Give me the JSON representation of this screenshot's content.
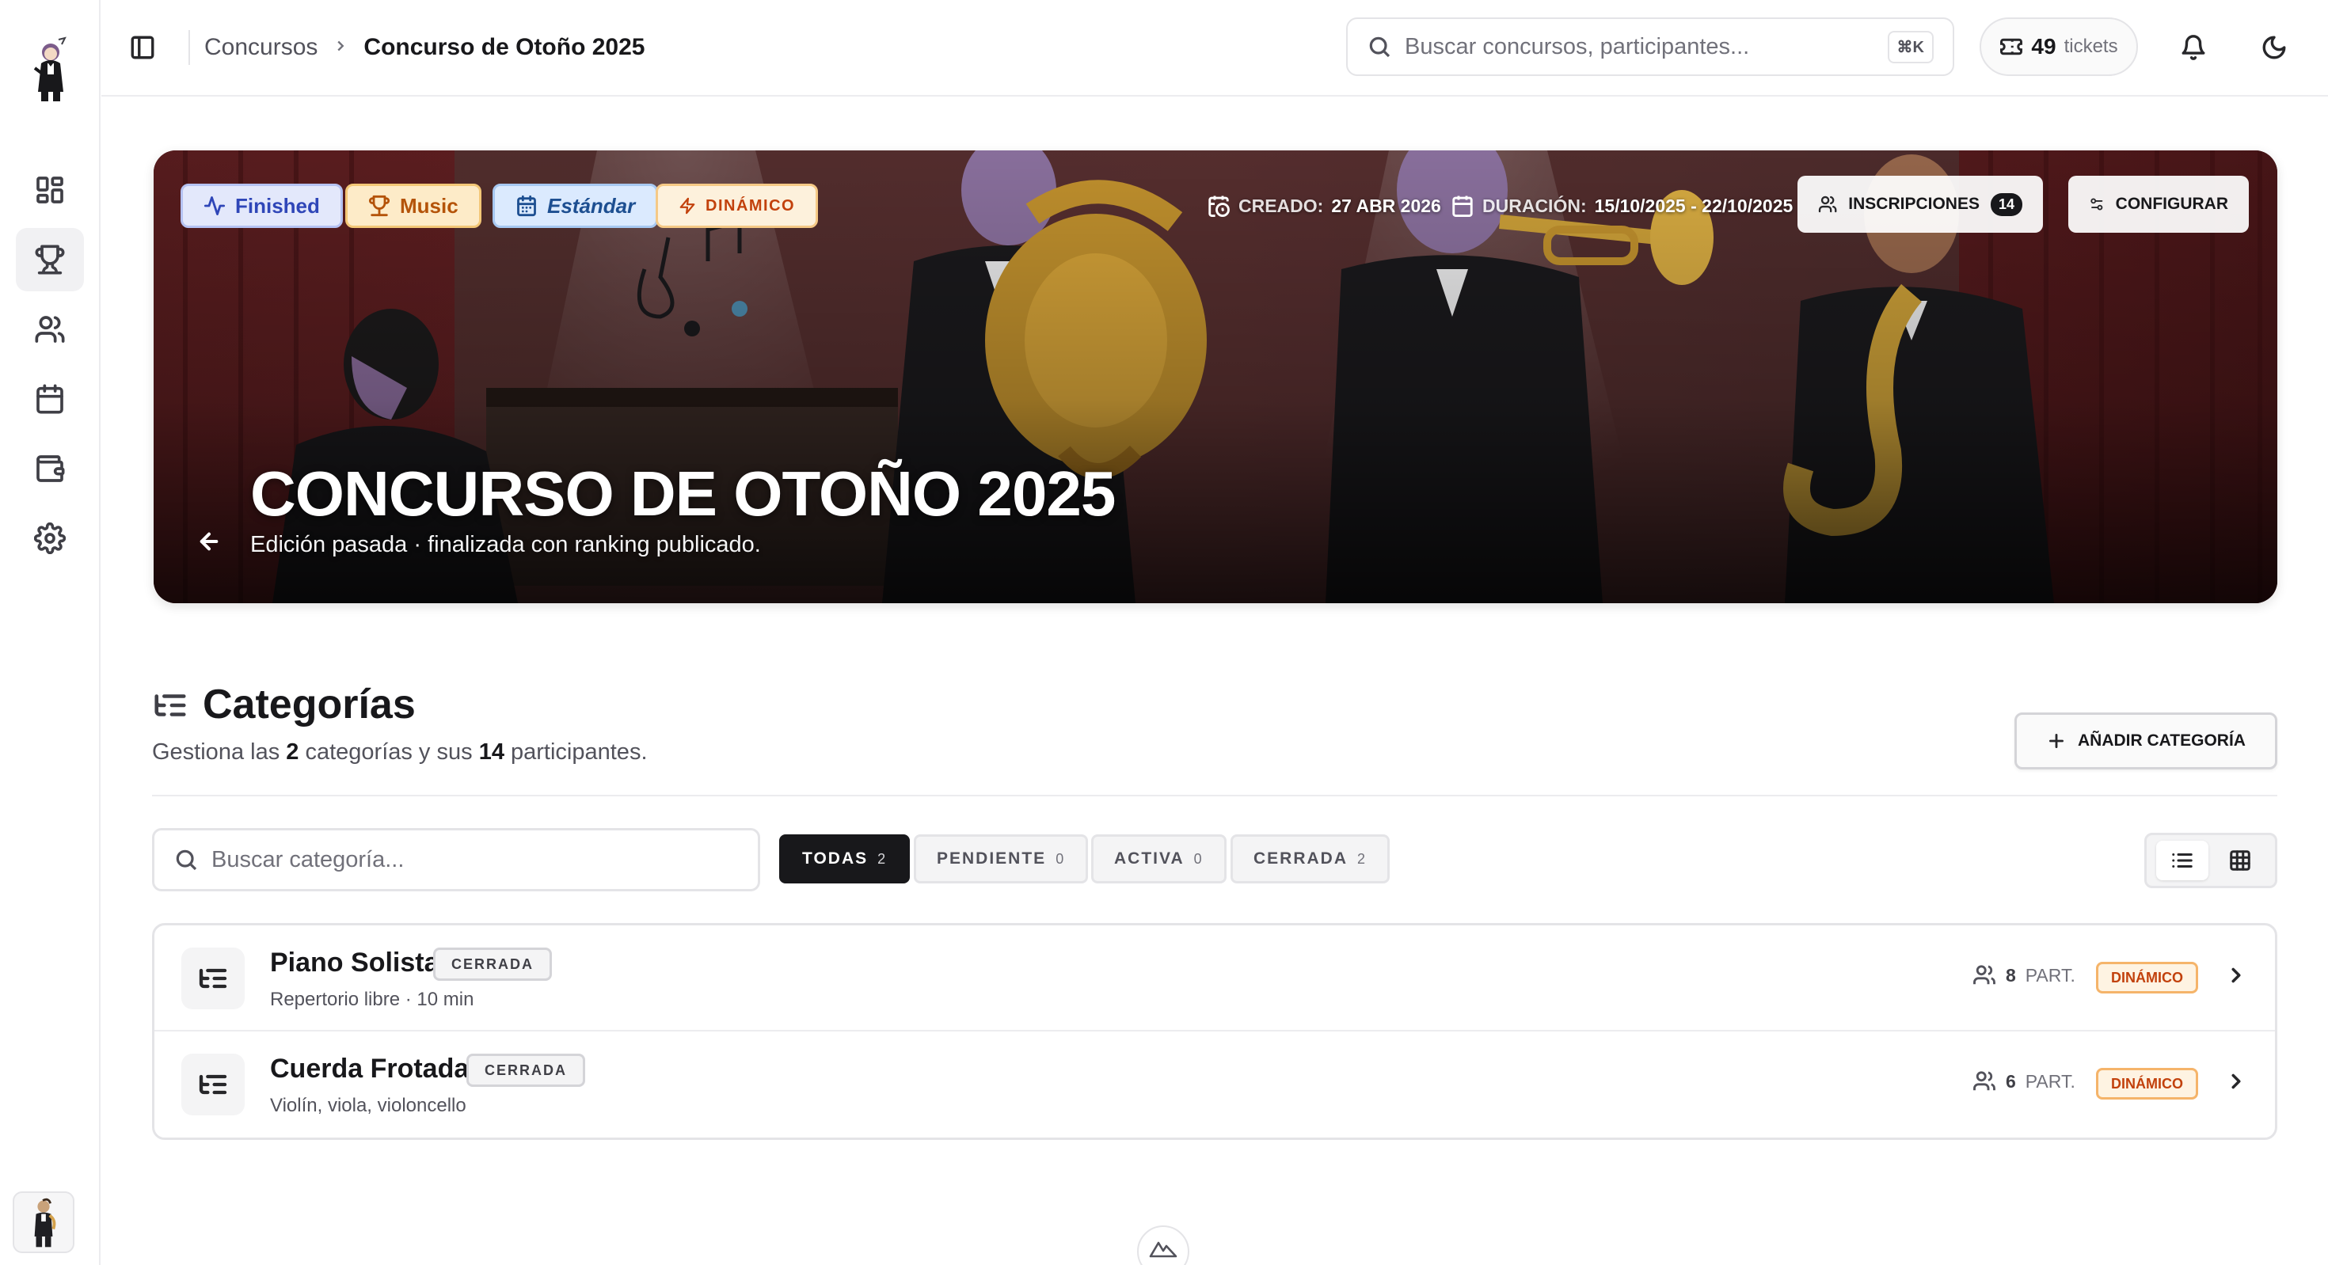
{
  "topbar": {
    "breadcrumb_parent": "Concursos",
    "breadcrumb_current": "Concurso de Otoño 2025",
    "search_placeholder": "Buscar concursos, participantes...",
    "search_shortcut": "⌘K",
    "tickets_count": "49",
    "tickets_label": "tickets"
  },
  "sidebar": {
    "items": [
      {
        "icon": "dashboard-icon",
        "active": false
      },
      {
        "icon": "trophy-icon",
        "active": true
      },
      {
        "icon": "users-icon",
        "active": false
      },
      {
        "icon": "calendar-icon",
        "active": false
      },
      {
        "icon": "wallet-icon",
        "active": false
      },
      {
        "icon": "gear-icon",
        "active": false
      }
    ]
  },
  "hero": {
    "status_chip": "Finished",
    "category_chip": "Music",
    "type_chip": "Estándar",
    "mode_chip": "DINÁMICO",
    "created_label": "CREADO:",
    "created_value": "27 ABR 2026",
    "duration_label": "DURACIÓN:",
    "duration_value": "15/10/2025 - 22/10/2025",
    "inscripciones_label": "INSCRIPCIONES",
    "inscripciones_count": "14",
    "configurar_label": "CONFIGURAR",
    "title": "CONCURSO DE OTOÑO 2025",
    "subtitle": "Edición pasada · finalizada con ranking publicado."
  },
  "categories": {
    "title": "Categorías",
    "desc_prefix": "Gestiona las ",
    "count_categories": "2",
    "desc_middle": " categorías y sus ",
    "count_participants": "14",
    "desc_suffix": " participantes.",
    "add_button": "AÑADIR CATEGORÍA",
    "search_placeholder": "Buscar categoría...",
    "filters": [
      {
        "label": "TODAS",
        "count": "2",
        "active": true
      },
      {
        "label": "PENDIENTE",
        "count": "0",
        "active": false
      },
      {
        "label": "ACTIVA",
        "count": "0",
        "active": false
      },
      {
        "label": "CERRADA",
        "count": "2",
        "active": false
      }
    ],
    "view_mode": "list",
    "items": [
      {
        "name": "Piano Solista",
        "status": "CERRADA",
        "desc": "Repertorio libre · 10 min",
        "participants": "8",
        "part_label": "PART.",
        "mode": "DINÁMICO"
      },
      {
        "name": "Cuerda Frotada",
        "status": "CERRADA",
        "desc": "Violín, viola, violoncello",
        "participants": "6",
        "part_label": "PART.",
        "mode": "DINÁMICO"
      }
    ]
  },
  "colors": {
    "accent_dark": "#18181b",
    "status_blue": "#2f46b8",
    "music_amber": "#b45309",
    "dynamic_orange": "#c2410c"
  }
}
